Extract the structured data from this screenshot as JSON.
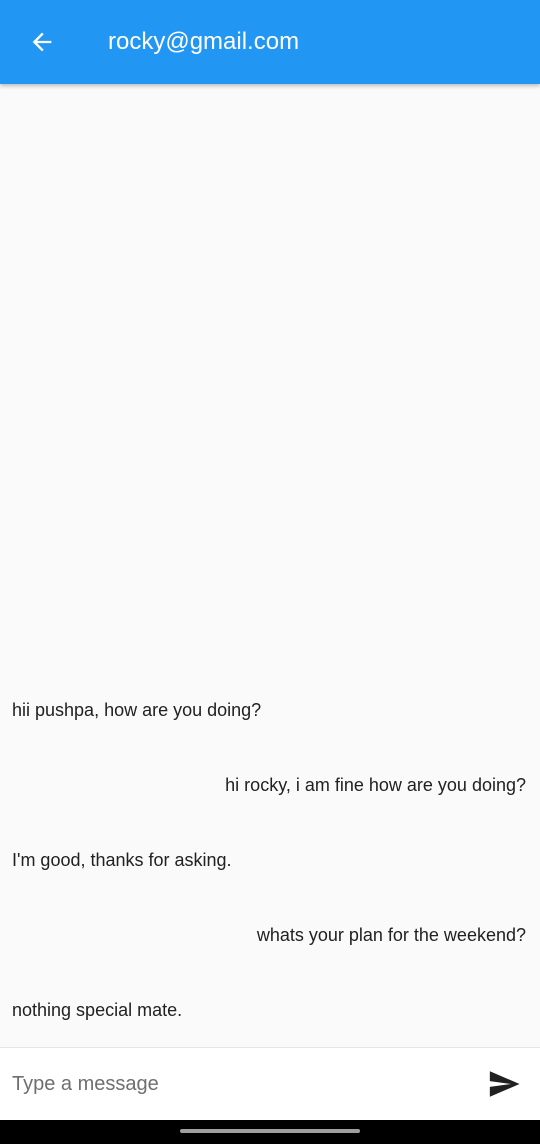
{
  "app_bar": {
    "title": "rocky@gmail.com",
    "back_icon": "arrow-back-icon",
    "background": "#2196f3"
  },
  "messages": [
    {
      "text": "hii pushpa, how are you doing?",
      "side": "left"
    },
    {
      "text": "hi rocky, i am fine how are you doing?",
      "side": "right"
    },
    {
      "text": "I'm good, thanks for asking.",
      "side": "left"
    },
    {
      "text": "whats your plan for the weekend?",
      "side": "right"
    },
    {
      "text": "nothing special mate.",
      "side": "left"
    }
  ],
  "composer": {
    "placeholder": "Type a message",
    "value": "",
    "send_icon": "send-icon"
  }
}
